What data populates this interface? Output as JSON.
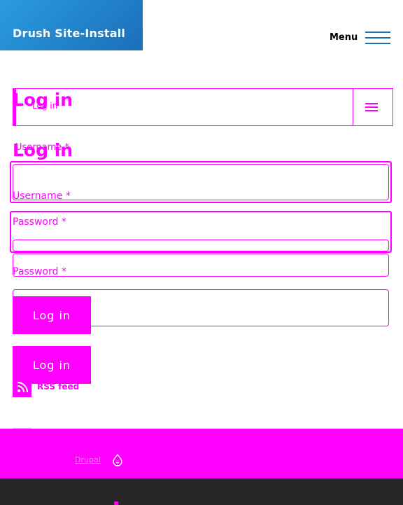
{
  "site": {
    "name": "Drush Site-Install"
  },
  "header": {
    "menu_label": "Menu"
  },
  "tabs": {
    "active_label": "Log in"
  },
  "page": {
    "title": "Log in"
  },
  "form": {
    "username_label": "Username *",
    "password_label": "Password *",
    "submit_label": "Log in"
  },
  "feed": {
    "label": "RSS feed"
  },
  "footer": {
    "powered_label": "Drupal"
  },
  "colors": {
    "brand_gradient_start": "#2a9be0",
    "brand_gradient_end": "#1b6fb8",
    "debug_accent": "#ff00ff",
    "footer_dark": "#262626"
  },
  "icons": {
    "menu": "hamburger-icon",
    "tabs_toggle": "hamburger-icon",
    "feed": "rss-icon",
    "drupal": "drupal-drop-icon"
  }
}
